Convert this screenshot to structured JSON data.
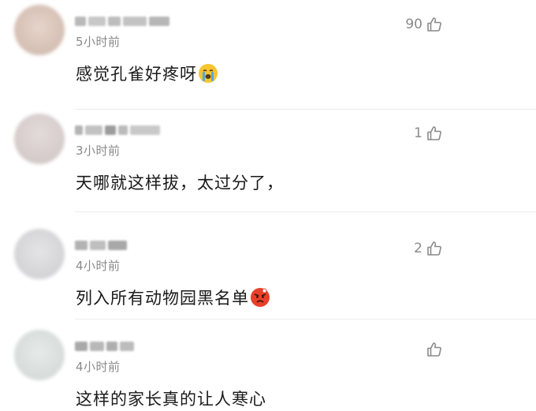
{
  "comments": [
    {
      "time": "5小时前",
      "text": "感觉孔雀好疼呀",
      "likes": "90",
      "emoji": "loudly-crying-emoji",
      "avatar_color": "#d9c6bd"
    },
    {
      "time": "3小时前",
      "text": "天哪就这样拔，太过分了，",
      "likes": "1",
      "emoji": "",
      "avatar_color": "#d8d0cf"
    },
    {
      "time": "4小时前",
      "text": "列入所有动物园黑名单",
      "likes": "2",
      "emoji": "angry-face-emoji",
      "avatar_color": "#d6d6d8"
    },
    {
      "time": "4小时前",
      "text": "这样的家长真的让人寒心",
      "likes": "",
      "emoji": "",
      "avatar_color": "#dadedc"
    }
  ],
  "colors": {
    "meta_text": "#8a8a8a",
    "body_text": "#1a1a1a",
    "background": "#ffffff"
  }
}
